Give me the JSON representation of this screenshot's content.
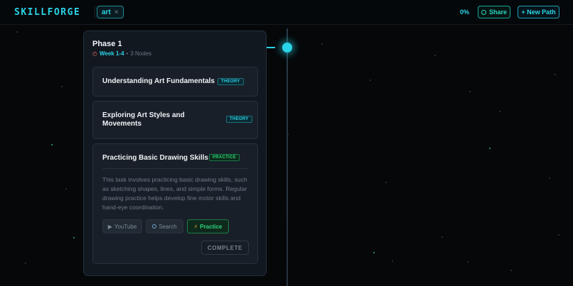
{
  "header": {
    "logo": "SKILLFORGE",
    "filter_tag": "art",
    "filter_tag_remove": "×",
    "progress": "0%",
    "share_label": "Share",
    "new_path_label": "+ New Path"
  },
  "phase": {
    "title": "Phase 1",
    "clock_glyph": "◴",
    "week": "Week 1-4",
    "separator": "•",
    "nodes": "3 Nodes",
    "tasks": [
      {
        "title": "Understanding Art Fundamentals",
        "badge": "THEORY"
      },
      {
        "title": "Exploring Art Styles and Movements",
        "badge": "THEORY"
      },
      {
        "title": "Practicing Basic Drawing Skills",
        "badge": "PRACTICE",
        "description": "This task involves practicing basic drawing skills, such as sketching shapes, lines, and simple forms. Regular drawing practice helps develop fine motor skills and hand-eye coordination.",
        "resources": {
          "youtube": "YouTube",
          "search": "Search",
          "practice": "Practice"
        },
        "complete_label": "COMPLETE"
      }
    ]
  },
  "icons": {
    "clock": "clock-icon",
    "play": "play-icon",
    "search": "search-icon",
    "bolt": "lightning-icon",
    "share": "ring-icon"
  },
  "colors": {
    "accent": "#2ad4e8",
    "practice": "#2fd37a",
    "background": "#050709",
    "card": "#121820"
  }
}
